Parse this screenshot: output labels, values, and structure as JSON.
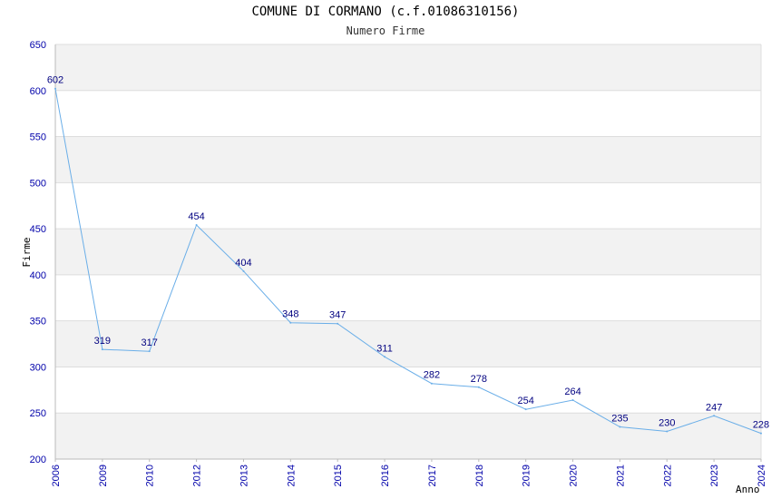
{
  "chart_data": {
    "type": "line",
    "title": "COMUNE DI CORMANO (c.f.01086310156)",
    "subtitle": "Numero Firme",
    "xlabel": "Anno",
    "ylabel": "Firme",
    "categories": [
      "2006",
      "2009",
      "2010",
      "2012",
      "2013",
      "2014",
      "2015",
      "2016",
      "2017",
      "2018",
      "2019",
      "2020",
      "2021",
      "2022",
      "2023",
      "2024"
    ],
    "series": [
      {
        "values": [
          602,
          319,
          317,
          454,
          404,
          348,
          347,
          311,
          282,
          278,
          254,
          264,
          235,
          230,
          247,
          228
        ]
      }
    ],
    "ylim": [
      200,
      650
    ],
    "yticks": [
      200,
      250,
      300,
      350,
      400,
      450,
      500,
      550,
      600,
      650
    ],
    "grid": true,
    "band_color": "#f2f2f2",
    "line_color": "#6aaee8",
    "tick_color": "#0000aa",
    "label_color": "#000080"
  }
}
